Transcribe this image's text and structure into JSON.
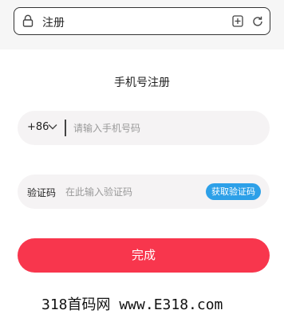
{
  "browser": {
    "tab_title": "注册",
    "icons": {
      "lock": "lock-icon",
      "bookmark": "bookmark-icon",
      "reload": "reload-icon"
    }
  },
  "page": {
    "heading": "手机号注册"
  },
  "phone": {
    "country_code": "+86",
    "placeholder": "请输入手机号码"
  },
  "verification": {
    "label": "验证码",
    "placeholder": "在此输入验证码",
    "get_code_label": "获取验证码"
  },
  "submit_label": "完成",
  "watermark": "318首码网 www.E318.com",
  "colors": {
    "primary": "#f8364d",
    "accent": "#2da0e8",
    "field_bg": "#f5f3f4"
  }
}
